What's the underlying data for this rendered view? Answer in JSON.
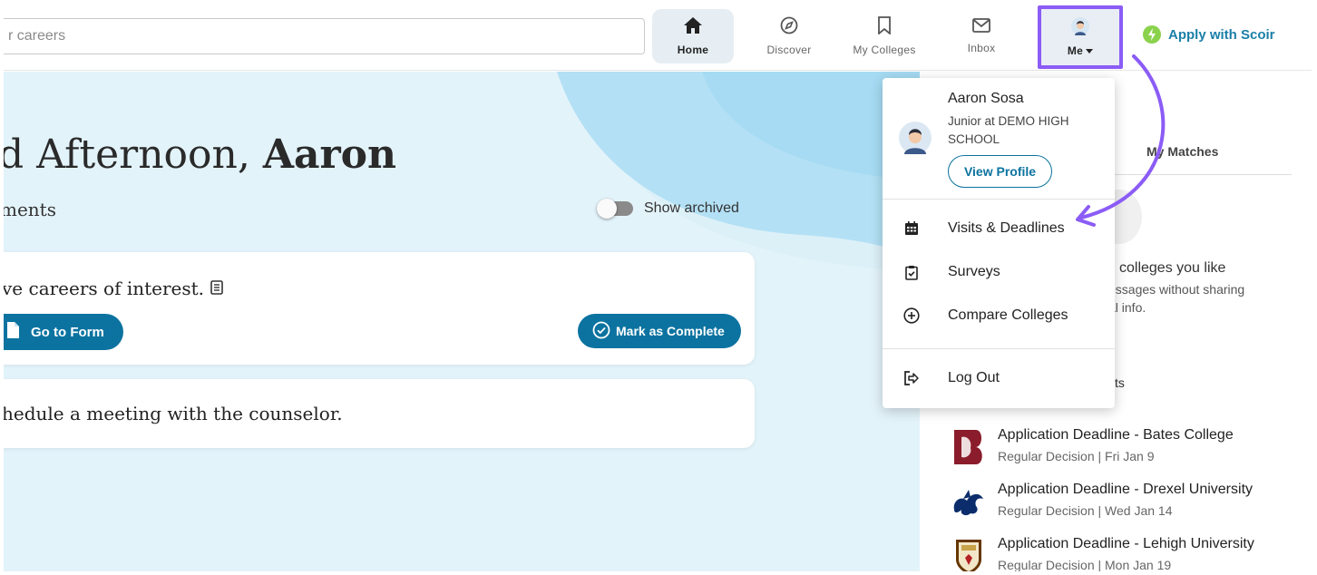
{
  "search": {
    "placeholder": "r careers"
  },
  "nav": {
    "home": "Home",
    "discover": "Discover",
    "my_colleges": "My Colleges",
    "inbox": "Inbox",
    "me": "Me",
    "apply": "Apply with Scoir"
  },
  "main": {
    "greeting_prefix": "d Afternoon, ",
    "greeting_name": "Aaron",
    "assignments_title": "ments",
    "show_archived": "Show archived",
    "task1_text": "ve careers of interest.",
    "go_to_form": "Go to Form",
    "mark_complete": "Mark as Complete",
    "task2_text": "hedule a meeting with the counselor."
  },
  "menu": {
    "name": "Aaron Sosa",
    "subtitle": "Junior at DEMO HIGH SCHOOL",
    "view_profile": "View Profile",
    "items": [
      {
        "label": "Visits & Deadlines",
        "icon": "calendar-icon"
      },
      {
        "label": "Surveys",
        "icon": "clipboard-check-icon"
      },
      {
        "label": "Compare Colleges",
        "icon": "plus-circle-icon"
      },
      {
        "label": "Log Out",
        "icon": "logout-icon"
      }
    ]
  },
  "right": {
    "my_matches": "My Matches",
    "text1": "colleges you like",
    "text2": "essages without sharing",
    "text3": "al info.",
    "text4": "ts",
    "deadlines": [
      {
        "title": "Application Deadline - Bates College",
        "detail": "Regular Decision | Fri Jan 9"
      },
      {
        "title": "Application Deadline - Drexel University",
        "detail": "Regular Decision | Wed Jan 14"
      },
      {
        "title": "Application Deadline - Lehigh University",
        "detail": "Regular Decision | Mon Jan 19"
      }
    ]
  },
  "colors": {
    "accent": "#0c73a0",
    "highlight": "#8b5cf6",
    "apply_text": "#1a7fa8",
    "bolt": "#8bd24c"
  }
}
